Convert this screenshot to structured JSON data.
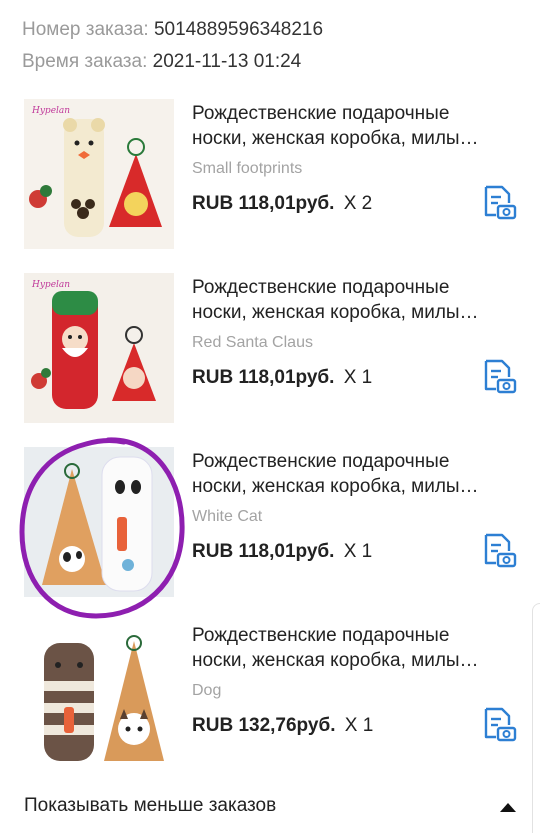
{
  "order": {
    "number_label": "Номер заказа:",
    "number_value": "5014889596348216",
    "time_label": "Время заказа:",
    "time_value": "2021-11-13 01:24"
  },
  "items": [
    {
      "title_line1": "Рождественские подарочные",
      "title_line2": "носки, женская коробка, милы…",
      "variant": "Small footprints",
      "price": "RUB 118,01руб.",
      "qty": "X 2",
      "thumb_icon": "socks-bear-photo",
      "action_icon": "document-camera-icon"
    },
    {
      "title_line1": "Рождественские подарочные",
      "title_line2": "носки, женская коробка, милы…",
      "variant": "Red Santa Claus",
      "price": "RUB 118,01руб.",
      "qty": "X 1",
      "thumb_icon": "socks-santa-photo",
      "action_icon": "document-camera-icon"
    },
    {
      "title_line1": "Рождественские подарочные",
      "title_line2": "носки, женская коробка, милы…",
      "variant": "White Cat",
      "price": "RUB 118,01руб.",
      "qty": "X 1",
      "thumb_icon": "socks-white-cat-photo",
      "action_icon": "document-camera-icon"
    },
    {
      "title_line1": "Рождественские подарочные",
      "title_line2": "носки, женская коробка, милы…",
      "variant": "Dog",
      "price": "RUB 132,76руб.",
      "qty": "X 1",
      "thumb_icon": "socks-dog-photo",
      "action_icon": "document-camera-icon"
    }
  ],
  "footer": {
    "label": "Показывать меньше заказов",
    "icon": "caret-up-icon"
  },
  "colors": {
    "accent_icon": "#2d7fd3",
    "highlight_circle": "#8e1fb0",
    "muted_text": "#9a9a9a"
  }
}
